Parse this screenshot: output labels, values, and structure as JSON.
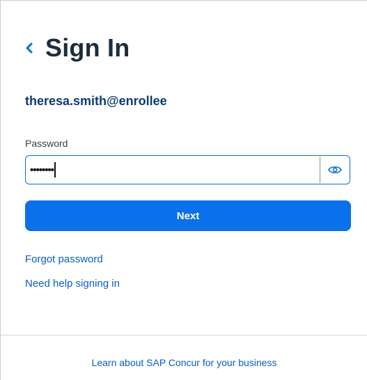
{
  "header": {
    "title": "Sign In",
    "back_icon": "chevron-left-icon"
  },
  "account": {
    "username": "theresa.smith@enrollee"
  },
  "password": {
    "label": "Password",
    "masked_value": "••••••••",
    "toggle_icon": "eye-icon"
  },
  "actions": {
    "next_label": "Next",
    "forgot_label": "Forgot password",
    "help_label": "Need help signing in"
  },
  "footer": {
    "link_label": "Learn about SAP Concur for your business"
  },
  "colors": {
    "accent": "#0a71eb",
    "link": "#0a5cc6",
    "username": "#0b3b73",
    "title": "#1d2d3e"
  }
}
